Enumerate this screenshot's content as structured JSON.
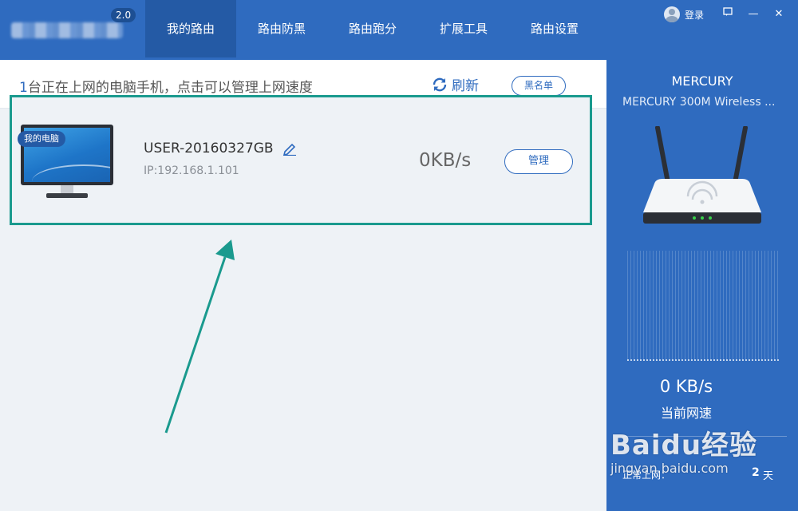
{
  "app": {
    "version": "2.0",
    "colors": {
      "primary": "#2f6bbf",
      "annotation": "#1a9a8e"
    }
  },
  "nav": {
    "tabs": [
      {
        "label": "我的路由",
        "active": true
      },
      {
        "label": "路由防黑",
        "active": false
      },
      {
        "label": "路由跑分",
        "active": false
      },
      {
        "label": "扩展工具",
        "active": false
      },
      {
        "label": "路由设置",
        "active": false
      }
    ]
  },
  "window": {
    "login_label": "登录",
    "buttons": {
      "feedback_icon": "chat-icon",
      "minimize": "—",
      "close": "✕"
    }
  },
  "header": {
    "count": "1",
    "text": "台正在上网的电脑手机，点击可以管理上网速度",
    "refresh_label": "刷新",
    "blacklist_label": "黑名单"
  },
  "devices": [
    {
      "badge": "我的电脑",
      "name": "USER-20160327GB",
      "ip": "IP:192.168.1.101",
      "speed": "0KB/s",
      "manage_label": "管理"
    }
  ],
  "router": {
    "brand": "MERCURY",
    "model": "MERCURY 300M Wireless ...",
    "current_speed": "0 KB/s",
    "current_speed_label": "当前网速",
    "uptime_label": "正常上网：",
    "uptime_value": "2",
    "uptime_unit": "天"
  },
  "watermark": {
    "logo": "Baidu经验",
    "url": "jingyan.baidu.com"
  }
}
